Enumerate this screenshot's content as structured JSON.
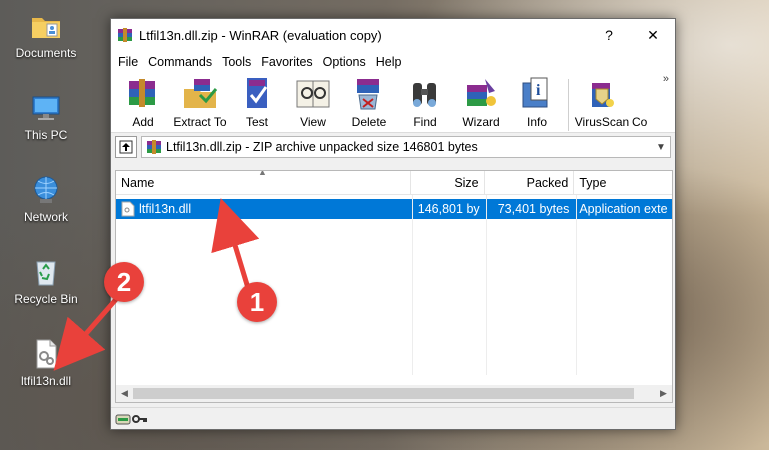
{
  "desktop": {
    "icons": [
      {
        "label": "Documents"
      },
      {
        "label": "This PC"
      },
      {
        "label": "Network"
      },
      {
        "label": "Recycle Bin"
      },
      {
        "label": "ltfil13n.dll"
      }
    ]
  },
  "window": {
    "title": "Ltfil13n.dll.zip - WinRAR (evaluation copy)",
    "help_button": "?",
    "close_button": "✕",
    "menu": [
      "File",
      "Commands",
      "Tools",
      "Favorites",
      "Options",
      "Help"
    ],
    "toolbar": [
      {
        "label": "Add",
        "icon": "add-icon"
      },
      {
        "label": "Extract To",
        "icon": "extract-icon"
      },
      {
        "label": "Test",
        "icon": "test-icon"
      },
      {
        "label": "View",
        "icon": "view-icon"
      },
      {
        "label": "Delete",
        "icon": "delete-icon"
      },
      {
        "label": "Find",
        "icon": "find-icon"
      },
      {
        "label": "Wizard",
        "icon": "wizard-icon"
      },
      {
        "label": "Info",
        "icon": "info-icon"
      },
      {
        "label": "VirusScan",
        "icon": "virusscan-icon"
      },
      {
        "label": "Co",
        "icon": "comment-icon"
      }
    ],
    "toolbar_more": "»",
    "address": "Ltfil13n.dll.zip - ZIP archive unpacked size 146801 bytes",
    "columns": [
      "Name",
      "Size",
      "Packed",
      "Type"
    ],
    "files": [
      {
        "name": "ltfil13n.dll",
        "size": "146,801 by",
        "packed": "73,401 bytes",
        "type": "Application exte"
      }
    ]
  },
  "annotations": {
    "badge_1": "1",
    "badge_2": "2"
  },
  "colors": {
    "selection": "#0078d7",
    "badge": "#e9413b"
  }
}
